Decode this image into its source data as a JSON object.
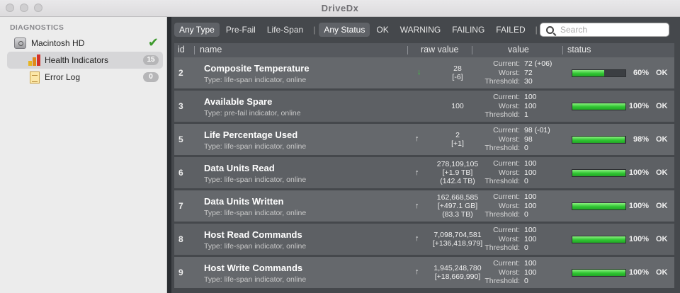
{
  "window": {
    "title": "DriveDx"
  },
  "sidebar": {
    "heading": "DIAGNOSTICS",
    "disk": {
      "label": "Macintosh HD",
      "status_icon": "green-check-icon"
    },
    "items": [
      {
        "label": "Health Indicators",
        "count": "15",
        "icon": "health-bars-icon"
      },
      {
        "label": "Error Log",
        "count": "0",
        "icon": "log-document-icon"
      }
    ]
  },
  "filters": {
    "type": [
      "Any Type",
      "Pre-Fail",
      "Life-Span"
    ],
    "status": [
      "Any Status",
      "OK",
      "WARNING",
      "FAILING",
      "FAILED"
    ],
    "search_placeholder": "Search"
  },
  "columns": {
    "id": "id",
    "name": "name",
    "raw": "raw value",
    "value": "value",
    "status": "status"
  },
  "value_labels": {
    "current": "Current:",
    "worst": "Worst:",
    "threshold": "Threshold:"
  },
  "colors": {
    "bar_green": "#2ec531",
    "trend_down": "#3ed43e"
  },
  "rows": [
    {
      "id": "2",
      "name": "Composite Temperature",
      "type": "Type: life-span indicator, online",
      "trend": "down",
      "raw": [
        "28",
        "[-6]"
      ],
      "current": "72 (+06)",
      "worst": "72",
      "threshold": "30",
      "health": 60,
      "pct": "60%",
      "status": "OK"
    },
    {
      "id": "3",
      "name": "Available Spare",
      "type": "Type: pre-fail indicator, online",
      "trend": "",
      "raw": [
        "100"
      ],
      "current": "100",
      "worst": "100",
      "threshold": "1",
      "health": 100,
      "pct": "100%",
      "status": "OK"
    },
    {
      "id": "5",
      "name": "Life Percentage Used",
      "type": "Type: life-span indicator, online",
      "trend": "up",
      "raw": [
        "2",
        "[+1]"
      ],
      "current": "98 (-01)",
      "worst": "98",
      "threshold": "0",
      "health": 98,
      "pct": "98%",
      "status": "OK"
    },
    {
      "id": "6",
      "name": "Data Units Read",
      "type": "Type: life-span indicator, online",
      "trend": "up",
      "raw": [
        "278,109,105",
        "[+1.9 TB]",
        "(142.4 TB)"
      ],
      "current": "100",
      "worst": "100",
      "threshold": "0",
      "health": 100,
      "pct": "100%",
      "status": "OK"
    },
    {
      "id": "7",
      "name": "Data Units Written",
      "type": "Type: life-span indicator, online",
      "trend": "up",
      "raw": [
        "162,668,585",
        "[+497.1 GB]",
        "(83.3 TB)"
      ],
      "current": "100",
      "worst": "100",
      "threshold": "0",
      "health": 100,
      "pct": "100%",
      "status": "OK"
    },
    {
      "id": "8",
      "name": "Host Read Commands",
      "type": "Type: life-span indicator, online",
      "trend": "up",
      "raw": [
        "7,098,704,581",
        "[+136,418,979]"
      ],
      "current": "100",
      "worst": "100",
      "threshold": "0",
      "health": 100,
      "pct": "100%",
      "status": "OK"
    },
    {
      "id": "9",
      "name": "Host Write Commands",
      "type": "Type: life-span indicator, online",
      "trend": "up",
      "raw": [
        "1,945,248,780",
        "[+18,669,990]"
      ],
      "current": "100",
      "worst": "100",
      "threshold": "0",
      "health": 100,
      "pct": "100%",
      "status": "OK"
    }
  ]
}
